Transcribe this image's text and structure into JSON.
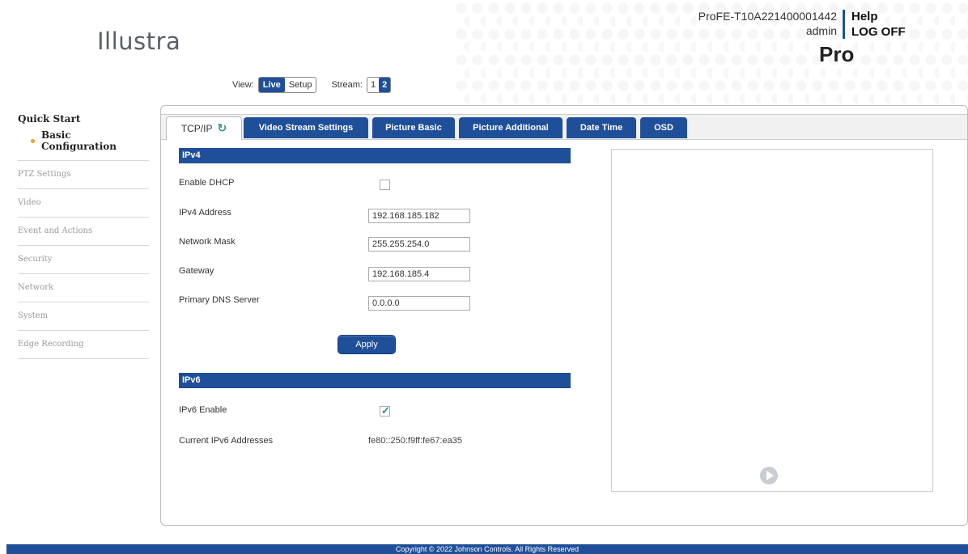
{
  "header": {
    "logo": "Illustra",
    "device_id": "ProFE-T10A221400001442",
    "username": "admin",
    "help": "Help",
    "logoff": "LOG OFF",
    "product": "Pro"
  },
  "view": {
    "label": "View:",
    "live": "Live",
    "setup": "Setup",
    "stream_label": "Stream:",
    "stream_1": "1",
    "stream_2": "2"
  },
  "sidebar": {
    "quick_start": "Quick Start",
    "basic_configuration": "Basic Configuration",
    "items": [
      "PTZ Settings",
      "Video",
      "Event and Actions",
      "Security",
      "Network",
      "System",
      "Edge Recording"
    ]
  },
  "tabs": [
    "TCP/IP",
    "Video Stream Settings",
    "Picture Basic",
    "Picture Additional",
    "Date Time",
    "OSD"
  ],
  "ipv4": {
    "header": "IPv4",
    "enable_dhcp_label": "Enable DHCP",
    "address_label": "IPv4 Address",
    "address_value": "192.168.185.182",
    "mask_label": "Network Mask",
    "mask_value": "255.255.254.0",
    "gateway_label": "Gateway",
    "gateway_value": "192.168.185.4",
    "dns_label": "Primary DNS Server",
    "dns_value": "0.0.0.0",
    "apply": "Apply"
  },
  "ipv6": {
    "header": "IPv6",
    "enable_label": "IPv6 Enable",
    "addresses_label": "Current IPv6 Addresses",
    "addresses_value": "fe80::250:f9ff:fe67:ea35"
  },
  "footer": "Copyright © 2022 Johnson Controls. All Rights Reserved",
  "icons": {
    "refresh": "refresh-icon",
    "check": "check-icon",
    "play": "play-icon"
  },
  "colors": {
    "primary": "#1f4f99",
    "bullet": "#e6a817",
    "refresh": "#3aa070"
  }
}
